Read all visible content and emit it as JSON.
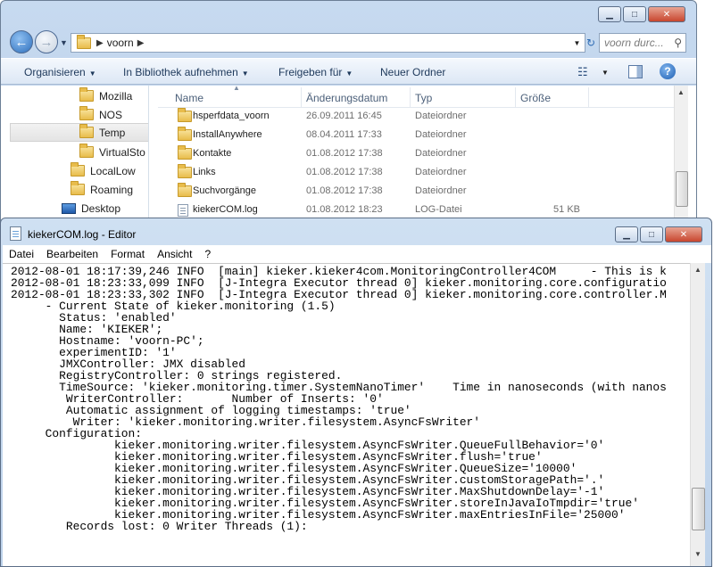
{
  "explorer": {
    "breadcrumb": "voorn",
    "search_placeholder": "voorn durc...",
    "toolbar": {
      "organize": "Organisieren",
      "library": "In Bibliothek aufnehmen",
      "share": "Freigeben für",
      "new_folder": "Neuer Ordner"
    },
    "nav_items": [
      {
        "label": "Mozilla",
        "icon": "folder-icon"
      },
      {
        "label": "NOS",
        "icon": "folder-icon"
      },
      {
        "label": "Temp",
        "icon": "folder-icon",
        "selected": true
      },
      {
        "label": "VirtualSto",
        "icon": "folder-icon"
      },
      {
        "label": "LocalLow",
        "icon": "folder-icon"
      },
      {
        "label": "Roaming",
        "icon": "folder-icon"
      },
      {
        "label": "Desktop",
        "icon": "desktop-icon"
      }
    ],
    "columns": {
      "name": "Name",
      "date": "Änderungsdatum",
      "type": "Typ",
      "size": "Größe"
    },
    "files": [
      {
        "name": "hsperfdata_voorn",
        "date": "26.09.2011 16:45",
        "type": "Dateiordner",
        "size": "",
        "icon": "folder-icon"
      },
      {
        "name": "InstallAnywhere",
        "date": "08.04.2011 17:33",
        "type": "Dateiordner",
        "size": "",
        "icon": "folder-icon"
      },
      {
        "name": "Kontakte",
        "date": "01.08.2012 17:38",
        "type": "Dateiordner",
        "size": "",
        "icon": "contacts-folder-icon"
      },
      {
        "name": "Links",
        "date": "01.08.2012 17:38",
        "type": "Dateiordner",
        "size": "",
        "icon": "links-folder-icon"
      },
      {
        "name": "Suchvorgänge",
        "date": "01.08.2012 17:38",
        "type": "Dateiordner",
        "size": "",
        "icon": "search-folder-icon"
      },
      {
        "name": "kiekerCOM.log",
        "date": "01.08.2012 18:23",
        "type": "LOG-Datei",
        "size": "51 KB",
        "icon": "log-file-icon"
      }
    ]
  },
  "notepad": {
    "title": "kiekerCOM.log - Editor",
    "menu": [
      "Datei",
      "Bearbeiten",
      "Format",
      "Ansicht",
      "?"
    ],
    "lines": [
      "2012-08-01 18:17:39,246 INFO  [main] kieker.kieker4com.MonitoringController4COM     - This is k",
      "2012-08-01 18:23:33,099 INFO  [J-Integra Executor thread 0] kieker.monitoring.core.configuratio",
      "2012-08-01 18:23:33,302 INFO  [J-Integra Executor thread 0] kieker.monitoring.core.controller.M",
      "     - Current State of kieker.monitoring (1.5)",
      "       Status: 'enabled'",
      "       Name: 'KIEKER';",
      "       Hostname: 'voorn-PC';",
      "       experimentID: '1'",
      "       JMXController: JMX disabled",
      "       RegistryController: 0 strings registered.",
      "       TimeSource: 'kieker.monitoring.timer.SystemNanoTimer'    Time in nanoseconds (with nanos",
      "        WriterController:       Number of Inserts: '0'",
      "        Automatic assignment of logging timestamps: 'true'",
      "         Writer: 'kieker.monitoring.writer.filesystem.AsyncFsWriter'",
      "     Configuration:",
      "               kieker.monitoring.writer.filesystem.AsyncFsWriter.QueueFullBehavior='0'",
      "               kieker.monitoring.writer.filesystem.AsyncFsWriter.flush='true'",
      "               kieker.monitoring.writer.filesystem.AsyncFsWriter.QueueSize='10000'",
      "               kieker.monitoring.writer.filesystem.AsyncFsWriter.customStoragePath='.'",
      "               kieker.monitoring.writer.filesystem.AsyncFsWriter.MaxShutdownDelay='-1'",
      "               kieker.monitoring.writer.filesystem.AsyncFsWriter.storeInJavaIoTmpdir='true'",
      "               kieker.monitoring.writer.filesystem.AsyncFsWriter.maxEntriesInFile='25000'",
      "        Records lost: 0 Writer Threads (1):"
    ]
  }
}
